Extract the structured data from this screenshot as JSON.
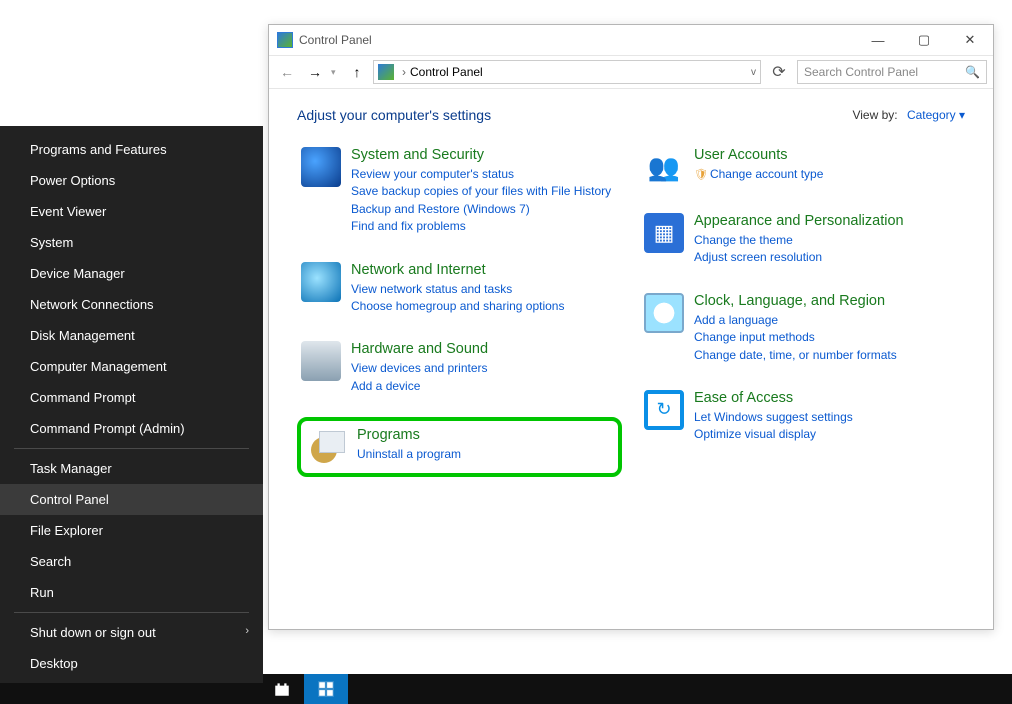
{
  "context_menu": {
    "group1": [
      "Programs and Features",
      "Power Options",
      "Event Viewer",
      "System",
      "Device Manager",
      "Network Connections",
      "Disk Management",
      "Computer Management",
      "Command Prompt",
      "Command Prompt (Admin)"
    ],
    "group2": [
      "Task Manager",
      "Control Panel",
      "File Explorer",
      "Search",
      "Run"
    ],
    "group3": [
      "Shut down or sign out",
      "Desktop"
    ],
    "has_submenu_index_g3": 0,
    "selected_item": "Control Panel"
  },
  "window": {
    "title": "Control Panel",
    "breadcrumb": [
      "Control Panel"
    ],
    "search_placeholder": "Search Control Panel",
    "heading": "Adjust your computer's settings",
    "viewby_label": "View by:",
    "viewby_value": "Category",
    "highlighted_category_index": [
      0,
      4
    ]
  },
  "categories_left": [
    {
      "title": "System and Security",
      "links": [
        "Review your computer's status",
        "Save backup copies of your files with File History",
        "Backup and Restore (Windows 7)",
        "Find and fix problems"
      ],
      "icon": "shield"
    },
    {
      "title": "Network and Internet",
      "links": [
        "View network status and tasks",
        "Choose homegroup and sharing options"
      ],
      "icon": "net"
    },
    {
      "title": "Hardware and Sound",
      "links": [
        "View devices and printers",
        "Add a device"
      ],
      "icon": "hw"
    },
    {
      "title": "Programs",
      "links": [
        "Uninstall a program"
      ],
      "icon": "prog"
    }
  ],
  "categories_right": [
    {
      "title": "User Accounts",
      "links": [
        "Change account type"
      ],
      "link_shield": [
        true
      ],
      "icon": "user"
    },
    {
      "title": "Appearance and Personalization",
      "links": [
        "Change the theme",
        "Adjust screen resolution"
      ],
      "icon": "appear"
    },
    {
      "title": "Clock, Language, and Region",
      "links": [
        "Add a language",
        "Change input methods",
        "Change date, time, or number formats"
      ],
      "icon": "clock"
    },
    {
      "title": "Ease of Access",
      "links": [
        "Let Windows suggest settings",
        "Optimize visual display"
      ],
      "icon": "ease"
    }
  ]
}
